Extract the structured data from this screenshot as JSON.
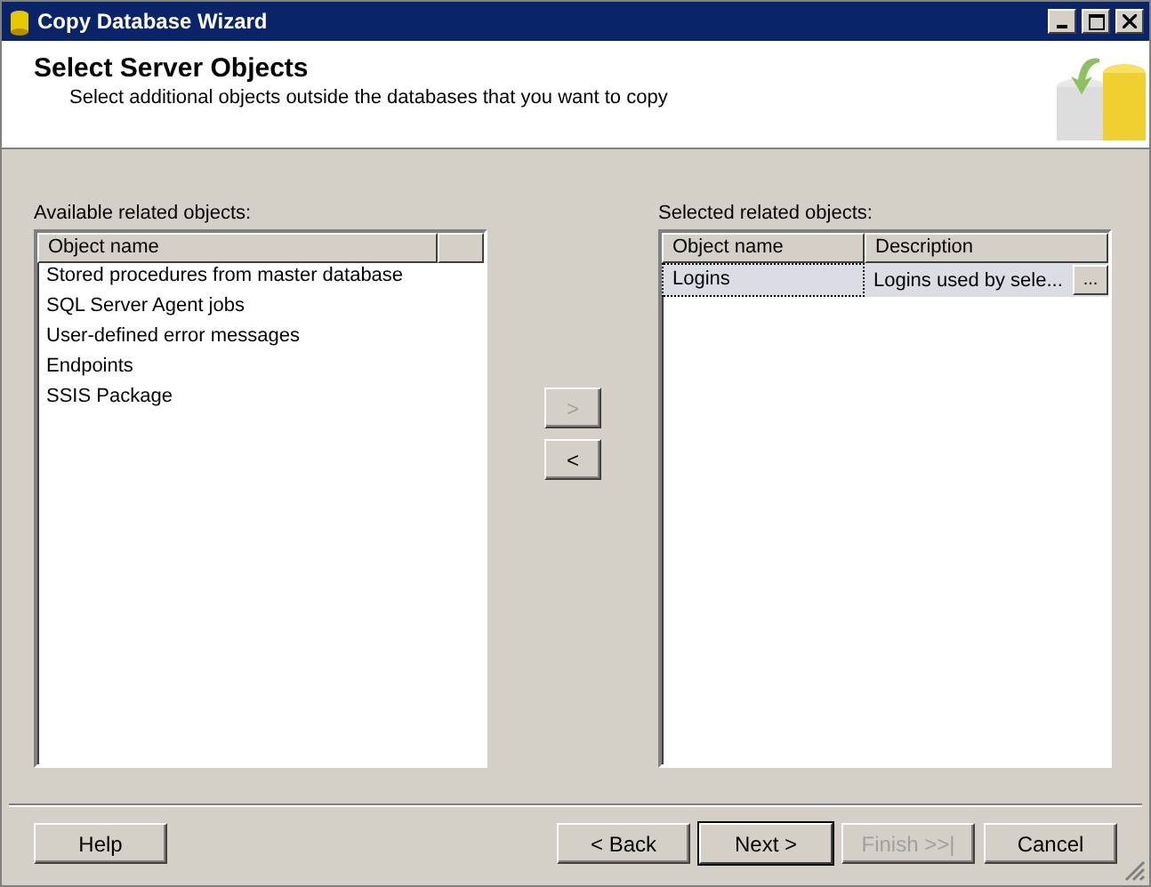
{
  "window": {
    "title": "Copy Database Wizard"
  },
  "header": {
    "title": "Select Server Objects",
    "subtitle": "Select additional objects outside the databases that you want to copy"
  },
  "available": {
    "label": "Available related objects:",
    "columns": [
      "Object name"
    ],
    "rows": [
      "Stored procedures from master database",
      "SQL Server Agent jobs",
      "User-defined error messages",
      "Endpoints",
      "SSIS Package"
    ]
  },
  "move_buttons": [
    {
      "label": ">",
      "disabled": true
    },
    {
      "label": "<",
      "disabled": false
    }
  ],
  "selected": {
    "label": "Selected related objects:",
    "columns": [
      "Object name",
      "Description"
    ],
    "rows": [
      {
        "name": "Logins",
        "description": "Logins used by sele...",
        "button": "...",
        "selected": true
      }
    ]
  },
  "buttons": [
    {
      "label": "Help",
      "disabled": false,
      "default": false
    },
    {
      "label": "< Back",
      "disabled": false,
      "default": false
    },
    {
      "label": "Next >",
      "disabled": false,
      "default": true
    },
    {
      "label": "Finish >>|",
      "disabled": true,
      "default": false
    },
    {
      "label": "Cancel",
      "disabled": false,
      "default": false
    }
  ]
}
